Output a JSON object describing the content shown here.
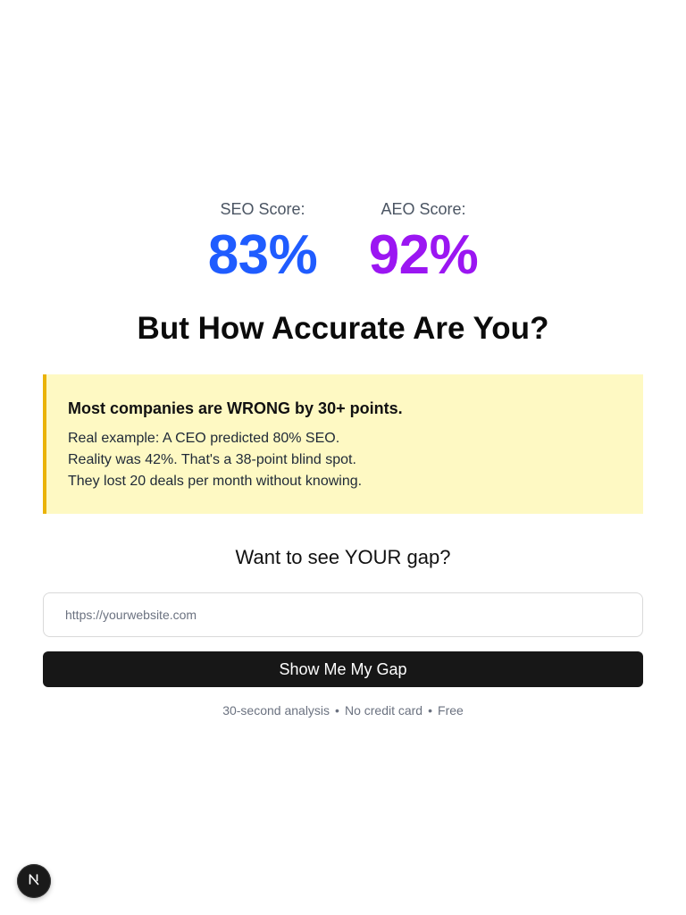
{
  "scores": {
    "seo": {
      "label": "SEO Score:",
      "value": "83%",
      "color": "#1f5cff"
    },
    "aeo": {
      "label": "AEO Score:",
      "value": "92%",
      "color": "#9b16f2"
    }
  },
  "headline": "But How Accurate Are You?",
  "callout": {
    "title": "Most companies are WRONG by 30+ points.",
    "lines": [
      "Real example: A CEO predicted 80% SEO.",
      "Reality was 42%. That's a 38-point blind spot.",
      "They lost 20 deals per month without knowing."
    ],
    "background": "#fef9c3",
    "accent": "#eab308"
  },
  "gap_question": "Want to see YOUR gap?",
  "url_input": {
    "placeholder": "https://yourwebsite.com",
    "value": ""
  },
  "cta_button": {
    "label": "Show Me My Gap"
  },
  "fine_print": [
    "30-second analysis",
    "No credit card",
    "Free"
  ],
  "fine_print_separator": "•",
  "dev_badge": {
    "icon": "nextjs-logo-icon"
  }
}
